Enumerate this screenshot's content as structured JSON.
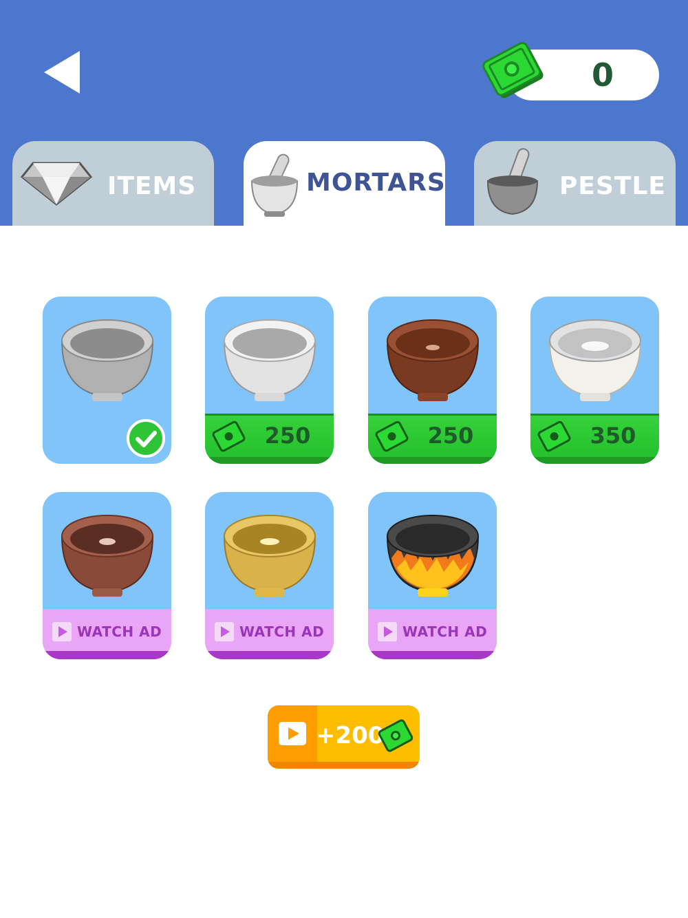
{
  "header": {
    "currency_value": "0"
  },
  "tabs": [
    {
      "label": "ITEMS",
      "icon": "diamond-icon",
      "active": false
    },
    {
      "label": "MORTARS",
      "icon": "mortar-icon",
      "active": true
    },
    {
      "label": "PESTLE",
      "icon": "pestle-icon",
      "active": false
    }
  ],
  "cards": [
    {
      "name": "stone-mortar",
      "status": "owned"
    },
    {
      "name": "marble-mortar",
      "price": "250"
    },
    {
      "name": "wood-mortar",
      "price": "250"
    },
    {
      "name": "pearl-mortar",
      "price": "350"
    },
    {
      "name": "copper-mortar",
      "action": "WATCH AD"
    },
    {
      "name": "gold-mortar",
      "action": "WATCH AD"
    },
    {
      "name": "flame-mortar",
      "action": "WATCH AD"
    }
  ],
  "reward": {
    "label": "+200"
  },
  "colors": {
    "header": "#4c77cd",
    "card": "#81c4fa",
    "price": "#21bf2a",
    "ad": "#e9a6f6",
    "reward": "#ffbd00"
  }
}
